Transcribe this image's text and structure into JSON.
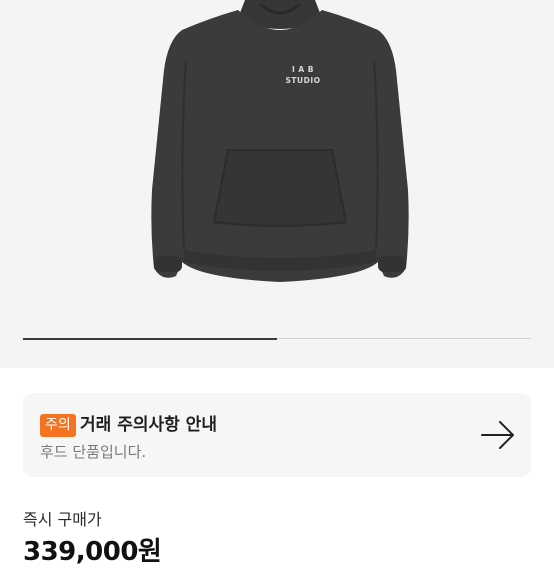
{
  "product": {
    "logo_top": "I A B",
    "logo_bottom": "STUDIO",
    "image_index": 1,
    "image_count": 2
  },
  "notice": {
    "badge": "주의",
    "title": "거래 주의사항 안내",
    "subtitle": "후드 단품입니다.",
    "badge_color": "#f37321",
    "arrow_icon": "arrow-right-icon"
  },
  "price": {
    "label": "즉시 구매가",
    "value": "339,000원"
  }
}
